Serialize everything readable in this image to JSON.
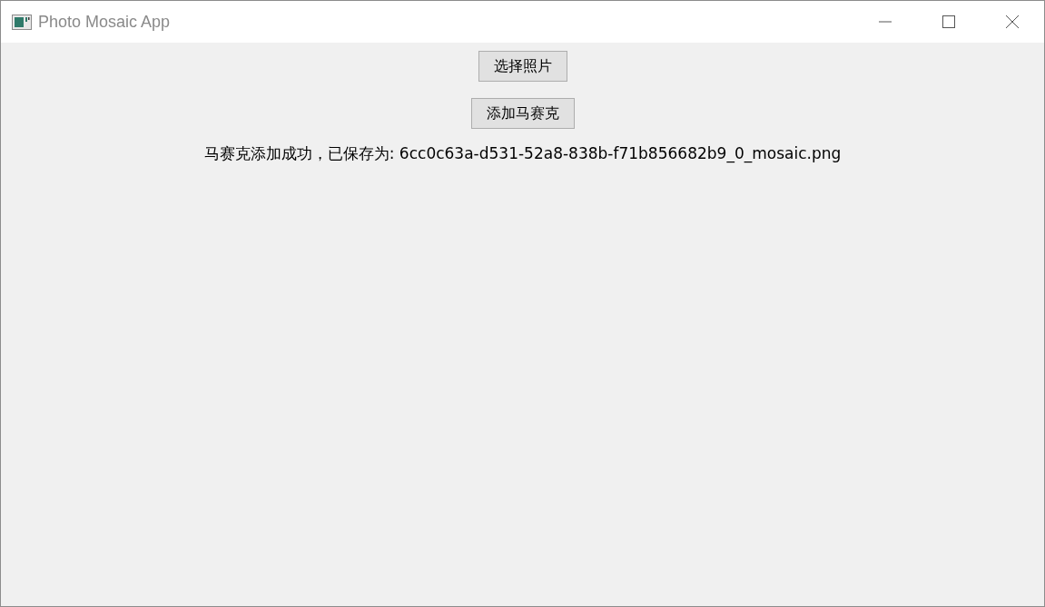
{
  "window": {
    "title": "Photo Mosaic App"
  },
  "buttons": [
    "选择照片",
    "添加马赛克"
  ],
  "status": "马赛克添加成功，已保存为: 6cc0c63a-d531-52a8-838b-f71b856682b9_0_mosaic.png"
}
